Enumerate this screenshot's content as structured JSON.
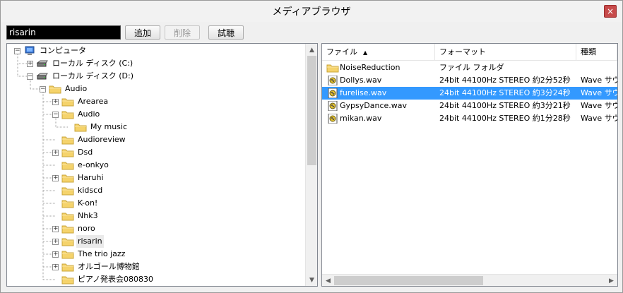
{
  "window": {
    "title": "メディアブラウザ",
    "close_glyph": "×"
  },
  "toolbar": {
    "search_value": "risarin",
    "add_label": "追加",
    "delete_label": "削除",
    "test_label": "試聴"
  },
  "tree": {
    "items": [
      {
        "label": "コンピュータ",
        "icon": "computer-icon",
        "expander": "−",
        "level": 0
      },
      {
        "label": "ローカル ディスク (C:)",
        "icon": "drive-icon",
        "expander": "+",
        "level": 1
      },
      {
        "label": "ローカル ディスク (D:)",
        "icon": "drive-icon",
        "expander": "−",
        "level": 1
      },
      {
        "label": "Audio",
        "icon": "folder-icon",
        "expander": "−",
        "level": 2
      },
      {
        "label": "Arearea",
        "icon": "folder-icon",
        "expander": "+",
        "level": 3
      },
      {
        "label": "Audio",
        "icon": "folder-icon",
        "expander": "−",
        "level": 3
      },
      {
        "label": "My music",
        "icon": "folder-icon",
        "expander": "",
        "level": 4
      },
      {
        "label": "Audioreview",
        "icon": "folder-icon",
        "expander": "",
        "level": 3
      },
      {
        "label": "Dsd",
        "icon": "folder-icon",
        "expander": "+",
        "level": 3
      },
      {
        "label": "e-onkyo",
        "icon": "folder-icon",
        "expander": "",
        "level": 3
      },
      {
        "label": "Haruhi",
        "icon": "folder-icon",
        "expander": "+",
        "level": 3
      },
      {
        "label": "kidscd",
        "icon": "folder-icon",
        "expander": "",
        "level": 3
      },
      {
        "label": "K-on!",
        "icon": "folder-icon",
        "expander": "",
        "level": 3
      },
      {
        "label": "Nhk3",
        "icon": "folder-icon",
        "expander": "",
        "level": 3
      },
      {
        "label": "noro",
        "icon": "folder-icon",
        "expander": "+",
        "level": 3
      },
      {
        "label": "risarin",
        "icon": "folder-icon",
        "expander": "+",
        "level": 3,
        "highlight": true
      },
      {
        "label": "The trio jazz",
        "icon": "folder-icon",
        "expander": "+",
        "level": 3
      },
      {
        "label": "オルゴール博物館",
        "icon": "folder-icon",
        "expander": "+",
        "level": 3
      },
      {
        "label": "ピアノ発表会080830",
        "icon": "folder-icon",
        "expander": "",
        "level": 3
      }
    ],
    "scroll_fraction": 0.0,
    "scroll_visible_fraction": 0.5
  },
  "list": {
    "columns": [
      {
        "label": "ファイル",
        "sort": "▲"
      },
      {
        "label": "フォーマット",
        "sort": ""
      },
      {
        "label": "種類",
        "sort": ""
      }
    ],
    "rows": [
      {
        "name": "NoiseReduction",
        "format": "ファイル フォルダ",
        "type": "",
        "icon": "folder-icon",
        "selected": false
      },
      {
        "name": "Dollys.wav",
        "format": "24bit 44100Hz STEREO 約2分52秒",
        "type": "Wave サウ",
        "icon": "wave-file-icon",
        "selected": false
      },
      {
        "name": "furelise.wav",
        "format": "24bit 44100Hz STEREO 約3分24秒",
        "type": "Wave サウ",
        "icon": "wave-file-icon",
        "selected": true
      },
      {
        "name": "GypsyDance.wav",
        "format": "24bit 44100Hz STEREO 約3分21秒",
        "type": "Wave サウ",
        "icon": "wave-file-icon",
        "selected": false
      },
      {
        "name": "mikan.wav",
        "format": "24bit 44100Hz STEREO 約1分28秒",
        "type": "Wave サウ",
        "icon": "wave-file-icon",
        "selected": false
      }
    ],
    "hscroll_fraction": 0.0,
    "hscroll_visible_fraction": 0.55
  },
  "colors": {
    "selection": "#3399ff",
    "folder": "#f5d36b",
    "close_button": "#c74a4a"
  }
}
